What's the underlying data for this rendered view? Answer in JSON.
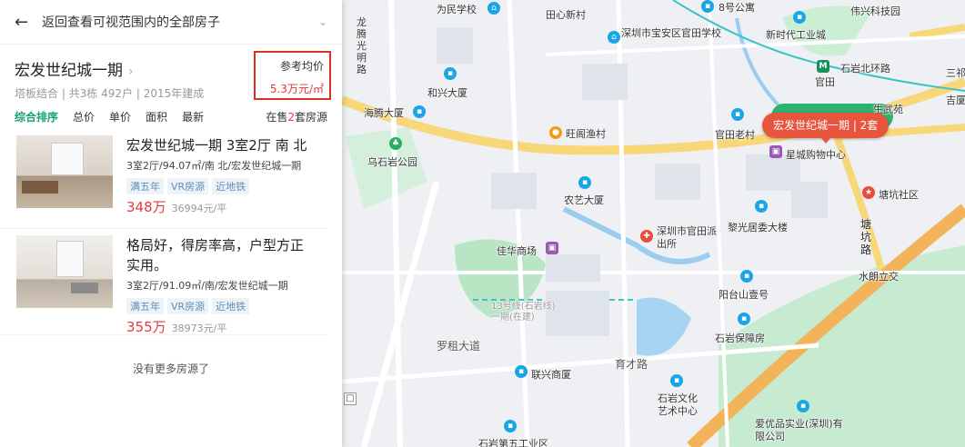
{
  "panel": {
    "back_text": "返回查看可视范围内的全部房子",
    "community": {
      "name": "宏发世纪城一期",
      "meta": "塔板结合 | 共3栋 492户 | 2015年建成",
      "price_label": "参考均价",
      "price_value": "5.3万元/㎡"
    },
    "sort": {
      "items": [
        "综合排序",
        "总价",
        "单价",
        "面积",
        "最新"
      ],
      "count_prefix": "在售",
      "count_num": "2",
      "count_suffix": "套房源"
    },
    "listings": [
      {
        "title": "宏发世纪城一期 3室2厅 南 北",
        "desc": "3室2厅/94.07㎡/南 北/宏发世纪城一期",
        "tags": [
          "满五年",
          "VR房源",
          "近地铁"
        ],
        "total": "348万",
        "unit": "36994元/平"
      },
      {
        "title": "格局好，得房率高，户型方正实用。",
        "desc": "3室2厅/91.09㎡/南/宏发世纪城一期",
        "tags": [
          "满五年",
          "VR房源",
          "近地铁"
        ],
        "total": "355万",
        "unit": "38973元/平"
      }
    ],
    "end_text": "没有更多房源了"
  },
  "map": {
    "bubble": "宏发世纪城一期 | 2套",
    "labels": {
      "weimin": "为民学校",
      "tianxin": "田心新村",
      "gongyu8": "8号公寓",
      "weixing": "伟兴科技园",
      "xinshidai": "新时代工业城",
      "guantian_school": "深圳市宝安区官田学校",
      "shiyanbei": "石岩北环路",
      "guantian": "官田",
      "sanqi": "三祁",
      "jifang": "吉厦",
      "hexing": "和兴大厦",
      "longteng": "龙腾光明路",
      "haiteng": "海腾大厦",
      "wangge": "旺阁渔村",
      "guantian_old": "官田老村",
      "xingcheng": "星城购物中心",
      "shengwu": "生武苑",
      "tangkeng": "塘坑社区",
      "wushi_park": "乌石岩公园",
      "nongyi": "农艺大厦",
      "guantian_police": "深圳市官田派出所",
      "liguang": "黎光居委大楼",
      "tangkeng_road": "塘坑路",
      "shuilang": "水朗立交",
      "jiahua": "佳华商场",
      "line13": "13号线(石岩线)一期(在建)",
      "yangtai": "阳台山壹号",
      "luozu": "罗租大道",
      "shiyan_bz": "石岩保障房",
      "lianxing": "联兴商厦",
      "yucai": "育才路",
      "shiyan_wh": "石岩文化艺术中心",
      "aiyou": "爱优品实业(深圳)有限公司",
      "shiyan5": "石岩第五工业区"
    }
  },
  "colors": {
    "accent_green": "#13a471",
    "price_red": "#e4393c",
    "bubble": "#e8553e",
    "metro": "#1a8f5a"
  }
}
